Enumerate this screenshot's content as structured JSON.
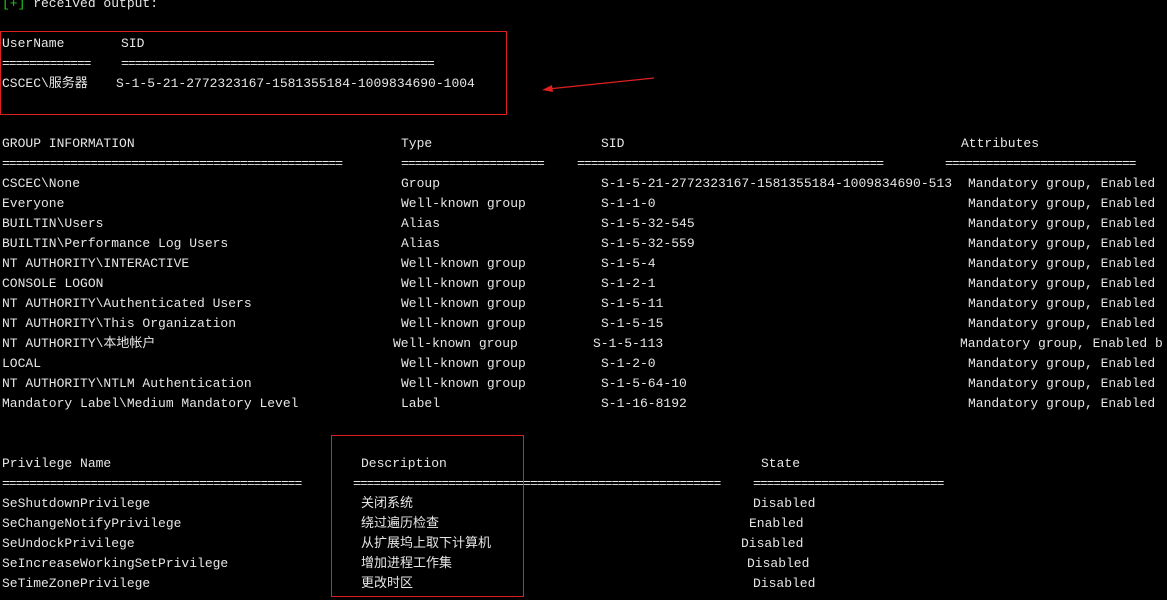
{
  "header": {
    "prefix": "[+]",
    "text": " received output:"
  },
  "user": {
    "headers": [
      "UserName",
      "SID"
    ],
    "sep1": "=============",
    "sep2": "==============================================",
    "row": {
      "name": "CSCEC\\服务器",
      "sid": "S-1-5-21-2772323167-1581355184-1009834690-1004"
    }
  },
  "groups": {
    "headers": [
      "GROUP INFORMATION",
      "Type",
      "SID",
      "Attributes"
    ],
    "sep": [
      "==================================================",
      "=====================",
      "=============================================",
      "============================"
    ],
    "rows": [
      {
        "name": "CSCEC\\None",
        "type": "Group",
        "sid": "S-1-5-21-2772323167-1581355184-1009834690-513",
        "attr": "Mandatory group, Enabled"
      },
      {
        "name": "Everyone",
        "type": "Well-known group",
        "sid": "S-1-1-0",
        "attr": "Mandatory group, Enabled"
      },
      {
        "name": "BUILTIN\\Users",
        "type": "Alias",
        "sid": "S-1-5-32-545",
        "attr": "Mandatory group, Enabled"
      },
      {
        "name": "BUILTIN\\Performance Log Users",
        "type": "Alias",
        "sid": "S-1-5-32-559",
        "attr": "Mandatory group, Enabled"
      },
      {
        "name": "NT AUTHORITY\\INTERACTIVE",
        "type": "Well-known group",
        "sid": "S-1-5-4",
        "attr": "Mandatory group, Enabled"
      },
      {
        "name": "CONSOLE LOGON",
        "type": "Well-known group",
        "sid": "S-1-2-1",
        "attr": "Mandatory group, Enabled"
      },
      {
        "name": "NT AUTHORITY\\Authenticated Users",
        "type": "Well-known group",
        "sid": "S-1-5-11",
        "attr": "Mandatory group, Enabled"
      },
      {
        "name": "NT AUTHORITY\\This Organization",
        "type": "Well-known group",
        "sid": "S-1-5-15",
        "attr": "Mandatory group, Enabled"
      },
      {
        "name": "NT AUTHORITY\\本地帐户",
        "type": "Well-known group",
        "sid": "S-1-5-113",
        "attr": "Mandatory group, Enabled b"
      },
      {
        "name": "LOCAL",
        "type": "Well-known group",
        "sid": "S-1-2-0",
        "attr": "Mandatory group, Enabled"
      },
      {
        "name": "NT AUTHORITY\\NTLM Authentication",
        "type": "Well-known group",
        "sid": "S-1-5-64-10",
        "attr": "Mandatory group, Enabled"
      },
      {
        "name": "Mandatory Label\\Medium Mandatory Level",
        "type": "Label",
        "sid": "S-1-16-8192",
        "attr": "Mandatory group, Enabled"
      }
    ]
  },
  "privileges": {
    "headers": [
      "Privilege Name",
      "Description",
      "State"
    ],
    "sep": [
      "============================================",
      "======================================================",
      "============================"
    ],
    "rows": [
      {
        "name": "SeShutdownPrivilege",
        "desc": "关闭系统",
        "state": "Disabled"
      },
      {
        "name": "SeChangeNotifyPrivilege",
        "desc": "绕过遍历检查",
        "state": "Enabled"
      },
      {
        "name": "SeUndockPrivilege",
        "desc": "从扩展坞上取下计算机",
        "state": "Disabled"
      },
      {
        "name": "SeIncreaseWorkingSetPrivilege",
        "desc": "增加进程工作集",
        "state": "Disabled"
      },
      {
        "name": "SeTimeZonePrivilege",
        "desc": "更改时区",
        "state": "Disabled"
      }
    ]
  },
  "colors": {
    "highlight": "#e02020",
    "prompt": "#23c423",
    "text": "#e6e6e6",
    "background": "#000000"
  }
}
